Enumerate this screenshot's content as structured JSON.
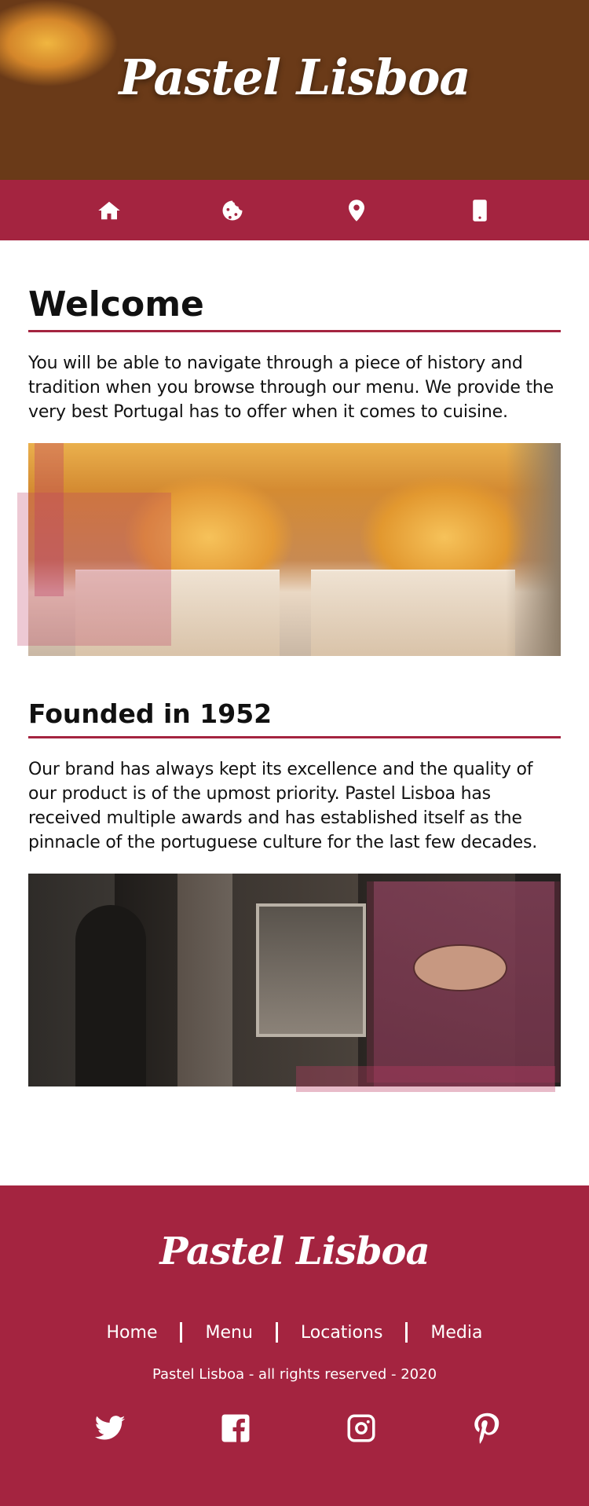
{
  "brand": {
    "name": "Pastel Lisboa",
    "accent_color": "#a42440"
  },
  "navbar": {
    "items": [
      {
        "icon": "home-icon",
        "label": "Home"
      },
      {
        "icon": "cookie-icon",
        "label": "Menu"
      },
      {
        "icon": "map-pin-icon",
        "label": "Locations"
      },
      {
        "icon": "mobile-phone-icon",
        "label": "Media"
      }
    ]
  },
  "sections": {
    "welcome": {
      "title": "Welcome",
      "body": "You will be able to navigate through a piece of history and tradition when you browse through our menu. We provide the very best Portugal has to offer when it comes to cuisine."
    },
    "founded": {
      "title": "Founded in 1952",
      "body": "Our brand has always kept its excellence and the quality of our product is of the upmost priority. Pastel Lisboa has received multiple awards and has established itself as the pinnacle of the portuguese culture for the last few decades."
    }
  },
  "footer": {
    "logo": "Pastel Lisboa",
    "links": [
      "Home",
      "Menu",
      "Locations",
      "Media"
    ],
    "copyright": "Pastel Lisboa - all rights reserved - 2020",
    "socials": [
      "twitter-icon",
      "facebook-icon",
      "instagram-icon",
      "pinterest-icon"
    ]
  }
}
